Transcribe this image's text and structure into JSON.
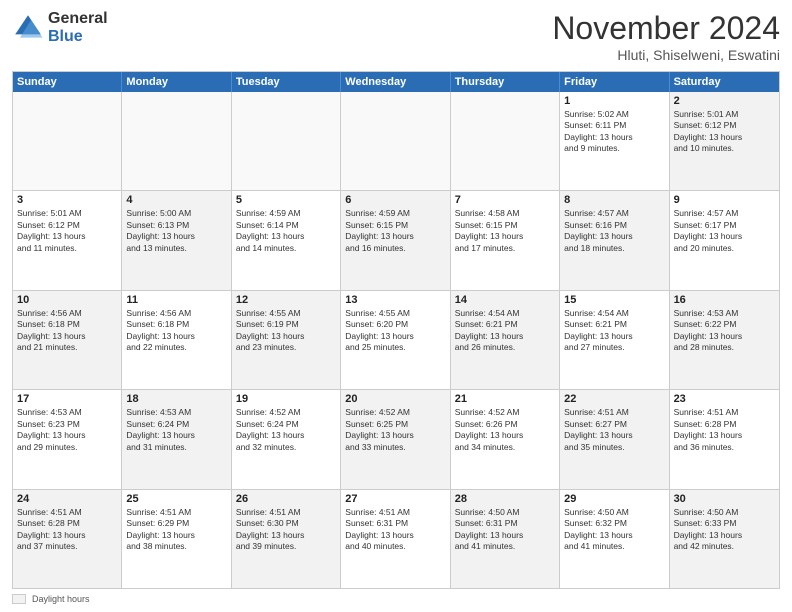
{
  "header": {
    "logo_general": "General",
    "logo_blue": "Blue",
    "title": "November 2024",
    "location": "Hluti, Shiselweni, Eswatini"
  },
  "weekdays": [
    "Sunday",
    "Monday",
    "Tuesday",
    "Wednesday",
    "Thursday",
    "Friday",
    "Saturday"
  ],
  "legend": {
    "label": "Daylight hours"
  },
  "weeks": [
    [
      {
        "day": "",
        "info": "",
        "empty": true
      },
      {
        "day": "",
        "info": "",
        "empty": true
      },
      {
        "day": "",
        "info": "",
        "empty": true
      },
      {
        "day": "",
        "info": "",
        "empty": true
      },
      {
        "day": "",
        "info": "",
        "empty": true
      },
      {
        "day": "1",
        "info": "Sunrise: 5:02 AM\nSunset: 6:11 PM\nDaylight: 13 hours\nand 9 minutes."
      },
      {
        "day": "2",
        "info": "Sunrise: 5:01 AM\nSunset: 6:12 PM\nDaylight: 13 hours\nand 10 minutes.",
        "shaded": true
      }
    ],
    [
      {
        "day": "3",
        "info": "Sunrise: 5:01 AM\nSunset: 6:12 PM\nDaylight: 13 hours\nand 11 minutes."
      },
      {
        "day": "4",
        "info": "Sunrise: 5:00 AM\nSunset: 6:13 PM\nDaylight: 13 hours\nand 13 minutes.",
        "shaded": true
      },
      {
        "day": "5",
        "info": "Sunrise: 4:59 AM\nSunset: 6:14 PM\nDaylight: 13 hours\nand 14 minutes."
      },
      {
        "day": "6",
        "info": "Sunrise: 4:59 AM\nSunset: 6:15 PM\nDaylight: 13 hours\nand 16 minutes.",
        "shaded": true
      },
      {
        "day": "7",
        "info": "Sunrise: 4:58 AM\nSunset: 6:15 PM\nDaylight: 13 hours\nand 17 minutes."
      },
      {
        "day": "8",
        "info": "Sunrise: 4:57 AM\nSunset: 6:16 PM\nDaylight: 13 hours\nand 18 minutes.",
        "shaded": true
      },
      {
        "day": "9",
        "info": "Sunrise: 4:57 AM\nSunset: 6:17 PM\nDaylight: 13 hours\nand 20 minutes."
      }
    ],
    [
      {
        "day": "10",
        "info": "Sunrise: 4:56 AM\nSunset: 6:18 PM\nDaylight: 13 hours\nand 21 minutes.",
        "shaded": true
      },
      {
        "day": "11",
        "info": "Sunrise: 4:56 AM\nSunset: 6:18 PM\nDaylight: 13 hours\nand 22 minutes."
      },
      {
        "day": "12",
        "info": "Sunrise: 4:55 AM\nSunset: 6:19 PM\nDaylight: 13 hours\nand 23 minutes.",
        "shaded": true
      },
      {
        "day": "13",
        "info": "Sunrise: 4:55 AM\nSunset: 6:20 PM\nDaylight: 13 hours\nand 25 minutes."
      },
      {
        "day": "14",
        "info": "Sunrise: 4:54 AM\nSunset: 6:21 PM\nDaylight: 13 hours\nand 26 minutes.",
        "shaded": true
      },
      {
        "day": "15",
        "info": "Sunrise: 4:54 AM\nSunset: 6:21 PM\nDaylight: 13 hours\nand 27 minutes."
      },
      {
        "day": "16",
        "info": "Sunrise: 4:53 AM\nSunset: 6:22 PM\nDaylight: 13 hours\nand 28 minutes.",
        "shaded": true
      }
    ],
    [
      {
        "day": "17",
        "info": "Sunrise: 4:53 AM\nSunset: 6:23 PM\nDaylight: 13 hours\nand 29 minutes."
      },
      {
        "day": "18",
        "info": "Sunrise: 4:53 AM\nSunset: 6:24 PM\nDaylight: 13 hours\nand 31 minutes.",
        "shaded": true
      },
      {
        "day": "19",
        "info": "Sunrise: 4:52 AM\nSunset: 6:24 PM\nDaylight: 13 hours\nand 32 minutes."
      },
      {
        "day": "20",
        "info": "Sunrise: 4:52 AM\nSunset: 6:25 PM\nDaylight: 13 hours\nand 33 minutes.",
        "shaded": true
      },
      {
        "day": "21",
        "info": "Sunrise: 4:52 AM\nSunset: 6:26 PM\nDaylight: 13 hours\nand 34 minutes."
      },
      {
        "day": "22",
        "info": "Sunrise: 4:51 AM\nSunset: 6:27 PM\nDaylight: 13 hours\nand 35 minutes.",
        "shaded": true
      },
      {
        "day": "23",
        "info": "Sunrise: 4:51 AM\nSunset: 6:28 PM\nDaylight: 13 hours\nand 36 minutes."
      }
    ],
    [
      {
        "day": "24",
        "info": "Sunrise: 4:51 AM\nSunset: 6:28 PM\nDaylight: 13 hours\nand 37 minutes.",
        "shaded": true
      },
      {
        "day": "25",
        "info": "Sunrise: 4:51 AM\nSunset: 6:29 PM\nDaylight: 13 hours\nand 38 minutes."
      },
      {
        "day": "26",
        "info": "Sunrise: 4:51 AM\nSunset: 6:30 PM\nDaylight: 13 hours\nand 39 minutes.",
        "shaded": true
      },
      {
        "day": "27",
        "info": "Sunrise: 4:51 AM\nSunset: 6:31 PM\nDaylight: 13 hours\nand 40 minutes."
      },
      {
        "day": "28",
        "info": "Sunrise: 4:50 AM\nSunset: 6:31 PM\nDaylight: 13 hours\nand 41 minutes.",
        "shaded": true
      },
      {
        "day": "29",
        "info": "Sunrise: 4:50 AM\nSunset: 6:32 PM\nDaylight: 13 hours\nand 41 minutes."
      },
      {
        "day": "30",
        "info": "Sunrise: 4:50 AM\nSunset: 6:33 PM\nDaylight: 13 hours\nand 42 minutes.",
        "shaded": true
      }
    ]
  ]
}
